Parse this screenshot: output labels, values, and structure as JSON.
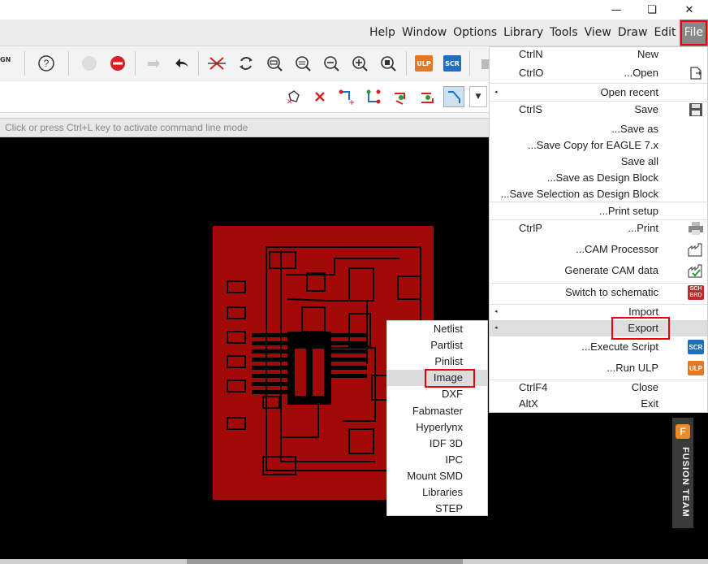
{
  "window": {
    "minimize_icon": "minimize-icon",
    "restore_icon": "restore-icon",
    "close_icon": "close-icon"
  },
  "menubar": {
    "items": [
      "File",
      "Edit",
      "Draw",
      "View",
      "Tools",
      "Library",
      "Options",
      "Window",
      "Help"
    ]
  },
  "toolbar1": {
    "partial_label": "GN"
  },
  "command_line": {
    "placeholder": "Click or press Ctrl+L key to activate command line mode"
  },
  "file_menu": {
    "items": [
      {
        "shortcut": "CtrlN",
        "label": "New",
        "icon": ""
      },
      {
        "shortcut": "CtrlO",
        "label": "...Open",
        "icon": "open-icon"
      },
      {
        "shortcut": "",
        "label": "Open recent",
        "icon": "",
        "submenu": true
      },
      {
        "shortcut": "CtrlS",
        "label": "Save",
        "icon": "save-icon"
      },
      {
        "shortcut": "",
        "label": "...Save as",
        "icon": ""
      },
      {
        "shortcut": "",
        "label": "...Save Copy for EAGLE 7.x",
        "icon": ""
      },
      {
        "shortcut": "",
        "label": "Save all",
        "icon": ""
      },
      {
        "shortcut": "",
        "label": "...Save as Design Block",
        "icon": ""
      },
      {
        "shortcut": "",
        "label": "...Save Selection as Design Block",
        "icon": ""
      },
      {
        "shortcut": "",
        "label": "...Print setup",
        "icon": ""
      },
      {
        "shortcut": "CtrlP",
        "label": "...Print",
        "icon": "print-icon"
      },
      {
        "shortcut": "",
        "label": "...CAM Processor",
        "icon": "cam-processor-icon"
      },
      {
        "shortcut": "",
        "label": "Generate CAM data",
        "icon": "generate-cam-icon"
      },
      {
        "shortcut": "",
        "label": "Switch to schematic",
        "icon": "sch-brd-icon"
      },
      {
        "shortcut": "",
        "label": "Import",
        "icon": "",
        "submenu": true
      },
      {
        "shortcut": "",
        "label": "Export",
        "icon": "",
        "submenu": true
      },
      {
        "shortcut": "",
        "label": "...Execute Script",
        "icon": "scr-icon"
      },
      {
        "shortcut": "",
        "label": "...Run ULP",
        "icon": "ulp-icon"
      },
      {
        "shortcut": "CtrlF4",
        "label": "Close",
        "icon": ""
      },
      {
        "shortcut": "AltX",
        "label": "Exit",
        "icon": ""
      }
    ]
  },
  "export_submenu": {
    "items": [
      "Netlist",
      "Partlist",
      "Pinlist",
      "Image",
      "DXF",
      "Fabmaster",
      "Hyperlynx",
      "IDF 3D",
      "IPC",
      "Mount SMD",
      "Libraries",
      "STEP"
    ],
    "selected": "Image"
  },
  "fusion_panel": {
    "logo": "F",
    "label": "FUSION TEAM"
  },
  "icons": {
    "scr": "SCR",
    "ulp": "ULP",
    "sch_top": "SCH",
    "sch_bottom": "BRD"
  },
  "colors": {
    "board": "#a30808",
    "highlight_border": "#e00000",
    "scr_blue": "#1e6fc0",
    "ulp_orange": "#e07a2a",
    "sch_red": "#c0282a",
    "fusion_orange": "#f08a24"
  }
}
